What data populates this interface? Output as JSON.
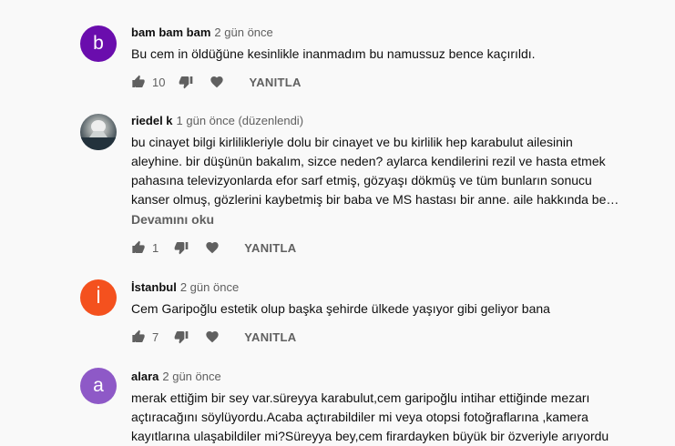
{
  "comments": [
    {
      "author": "bam bam bam",
      "meta": "2 gün önce",
      "avatar_letter": "b",
      "avatar_color": "#6a0dad",
      "lines": [
        "Bu cem in öldüğüne kesinlikle inanmadım bu namussuz bence kaçırıldı."
      ],
      "likes": "10",
      "reply_label": "YANITLA"
    },
    {
      "author": "riedel k",
      "meta": "1 gün önce (düzenlendi)",
      "avatar_letter": "",
      "avatar_color": "#3d4a52",
      "lines": [
        "bu cinayet bilgi kirlilikleriyle dolu bir cinayet ve bu kirlilik hep karabulut ailesinin",
        "aleyhine. bir düşünün bakalım, sizce neden? aylarca kendilerini rezil ve hasta etmek",
        "pahasına televizyonlarda efor sarf etmiş, gözyaşı dökmüş ve tüm bunların sonucu",
        "kanser olmuş, gözlerini kaybetmiş bir baba ve MS hastası bir anne. aile hakkında be…"
      ],
      "more_label": "Devamını oku",
      "likes": "1",
      "reply_label": "YANITLA"
    },
    {
      "author": "İstanbul",
      "meta": "2 gün önce",
      "avatar_letter": "İ",
      "avatar_color": "#f4511e",
      "lines": [
        "Cem Garipoğlu estetik olup başka şehirde ülkede yaşıyor gibi geliyor bana"
      ],
      "likes": "7",
      "reply_label": "YANITLA"
    },
    {
      "author": "alara",
      "meta": "2 gün önce",
      "avatar_letter": "a",
      "avatar_color": "#8e59c7",
      "lines": [
        "merak ettiğim bir sey var.süreyya karabulut,cem garipoğlu intihar ettiğinde mezarı",
        "açtıracağını söylüyordu.Acaba açtırabildiler mi veya otopsi fotoğraflarına ,kamera",
        "kayıtlarına ulaşabildiler mi?Süreyya bey,cem firardayken büyük bir özveriyle arıyordu"
      ]
    }
  ],
  "icons": {
    "like": "thumbs-up-icon",
    "dislike": "thumbs-down-icon",
    "heart": "heart-icon"
  }
}
